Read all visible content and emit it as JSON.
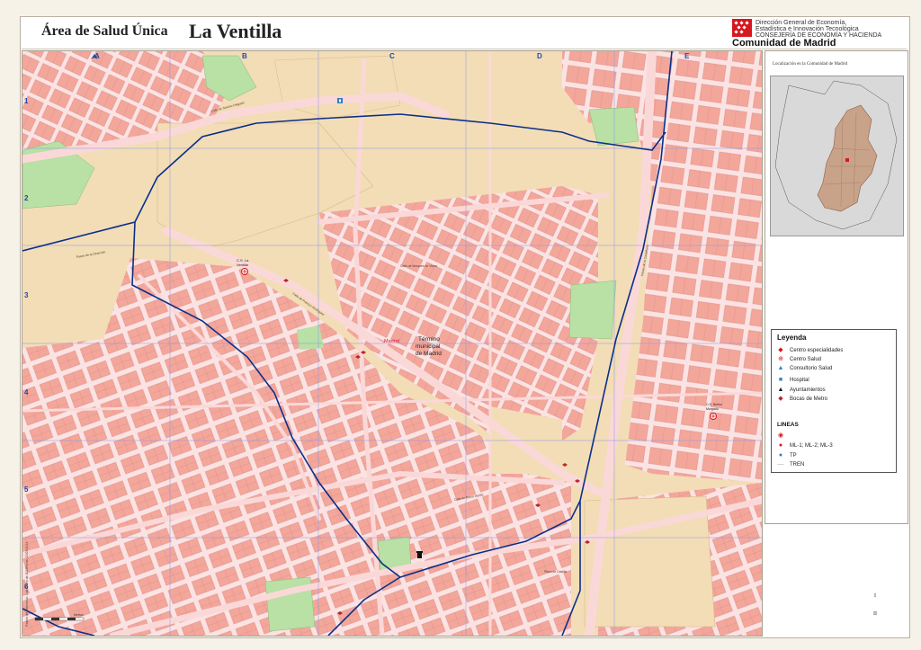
{
  "header": {
    "area_title": "Área de Salud Única",
    "area_name": "La Ventilla",
    "brand_line1": "Dirección General de Economía,",
    "brand_line2": "Estadística e Innovación Tecnológica",
    "brand_line3": "CONSEJERÍA DE ECONOMÍA Y HACIENDA",
    "brand_name": "Comunidad de Madrid"
  },
  "map": {
    "grid_columns": [
      "A",
      "B",
      "C",
      "D",
      "E"
    ],
    "grid_rows": [
      "1",
      "2",
      "3",
      "4",
      "5",
      "6"
    ],
    "municipality_label": "Término\nmunicipal\nde Madrid",
    "municipality_line1": "Término",
    "municipality_line2": "municipal",
    "municipality_line3": "de Madrid",
    "district_tag": "Madrid",
    "health_center_1": "C.S. La\nVentilla",
    "health_center_1_line1": "C.S. La",
    "health_center_1_line2": "Ventilla",
    "health_center_2_line1": "C.S. Núñez",
    "health_center_2_line2": "Morgado",
    "margin_text": "Fecha: 21/03/2014",
    "margin_text_2": "Padrón de referencia: 1 de Enero de 2013",
    "scale_label": "Metros"
  },
  "sidebar": {
    "location_title": "Localización en la Comunidad de Madrid",
    "legend": {
      "title": "Leyenda",
      "items": [
        {
          "label": "Centro especialidades",
          "icon": "specialty-center-icon",
          "color": "#d7171f"
        },
        {
          "label": "Centro Salud",
          "icon": "health-center-icon",
          "color": "#d7171f"
        },
        {
          "label": "Consultorio Salud",
          "icon": "clinic-icon",
          "color": "#2f7fc1"
        },
        {
          "label": "Hospital",
          "icon": "hospital-icon",
          "color": "#2f7fc1"
        },
        {
          "label": "Ayuntamientos",
          "icon": "town-hall-icon",
          "color": "#111111"
        },
        {
          "label": "Bocas de Metro",
          "icon": "metro-entrance-icon",
          "color": "#b8262b"
        }
      ],
      "lines_title": "LINEAS",
      "lines": [
        {
          "label": "",
          "icon": "metro-line-icon",
          "color": "#d7171f"
        },
        {
          "label": "ML-1; ML-2; ML-3",
          "icon": "light-rail-icon",
          "color": "#d7171f"
        },
        {
          "label": "TP",
          "icon": "tp-icon",
          "color": "#2f7fc1"
        },
        {
          "label": "TREN",
          "icon": "train-line-icon",
          "color": "#9aa6b8"
        }
      ]
    },
    "roman_1": "I",
    "roman_2": "II"
  },
  "colors": {
    "background": "#f2ddb7",
    "blocks": "#f3a79b",
    "streets": "#f8d6d6",
    "parks": "#b9e0a5",
    "boundary": "#0b2f8a",
    "grid": "#7f8fe0"
  }
}
